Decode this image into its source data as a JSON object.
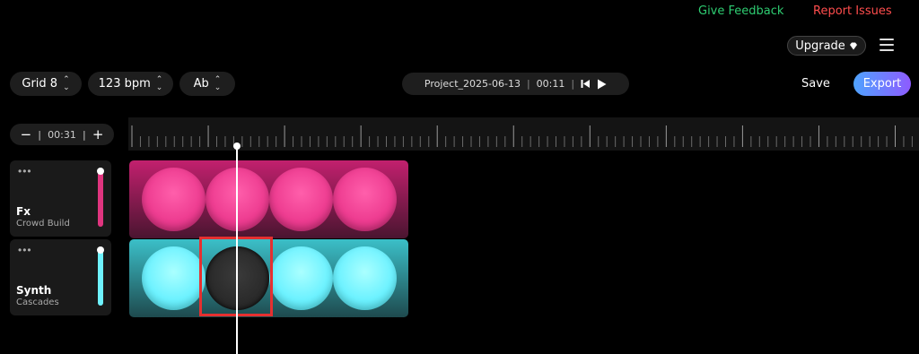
{
  "header": {
    "feedback_label": "Give Feedback",
    "report_label": "Report Issues",
    "upgrade_label": "Upgrade",
    "feedback_color": "#2ecc71",
    "report_color": "#ff4d4d"
  },
  "toolbar": {
    "grid_label": "Grid 8",
    "bpm_label": "123 bpm",
    "key_label": "Ab",
    "project_name": "Project_2025-06-13",
    "project_time": "00:11",
    "save_label": "Save",
    "export_label": "Export"
  },
  "zoom": {
    "minus": "−",
    "duration": "00:31",
    "plus": "+"
  },
  "tracks": [
    {
      "name": "Fx",
      "subtitle": "Crowd Build",
      "color": "#e0357f",
      "volume": 1.0
    },
    {
      "name": "Synth",
      "subtitle": "Cascades",
      "color": "#6ef2ff",
      "volume": 1.0
    }
  ],
  "icons": {
    "menu": "hamburger-icon",
    "upgrade": "gem-icon",
    "skip_back": "skip-back-icon",
    "play": "play-icon",
    "more": "ellipsis-icon"
  }
}
